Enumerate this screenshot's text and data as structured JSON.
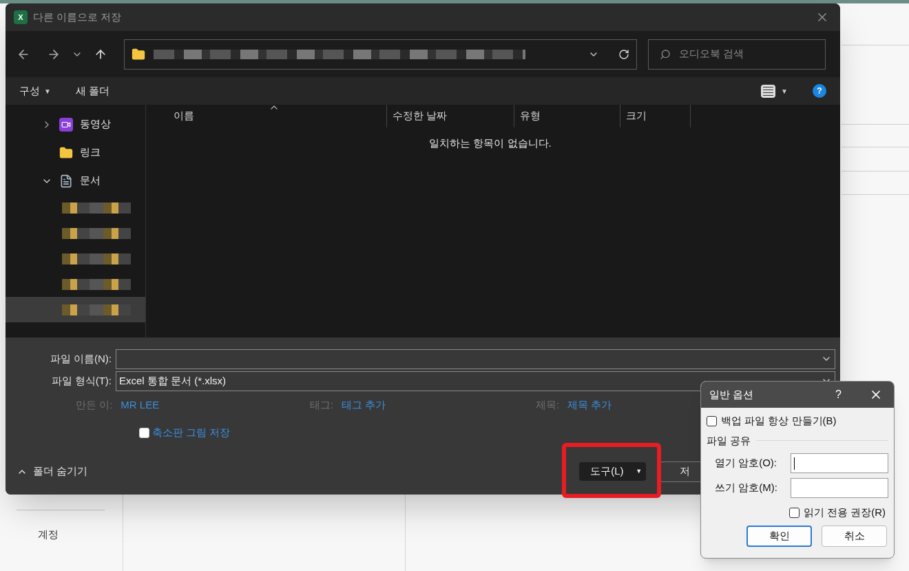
{
  "background": {
    "account": "계정"
  },
  "window": {
    "title": "다른 이름으로 저장"
  },
  "search": {
    "placeholder": "오디오북 검색"
  },
  "app_icon": "X",
  "toolbar": {
    "organize": "구성",
    "organize_caret": "▼",
    "new_folder": "새 폴더",
    "view_caret": "▼",
    "help": "?"
  },
  "sidebar": {
    "items": [
      {
        "label": "동영상",
        "kind": "videos",
        "expandable": true,
        "expanded": false
      },
      {
        "label": "링크",
        "kind": "folder",
        "expandable": false
      },
      {
        "label": "문서",
        "kind": "documents",
        "expandable": true,
        "expanded": true
      }
    ],
    "hidden_items": [
      {
        "selected": false
      },
      {
        "selected": false
      },
      {
        "selected": false
      },
      {
        "selected": false
      },
      {
        "selected": true
      }
    ]
  },
  "table": {
    "columns": [
      {
        "label": "이름",
        "sorted": true
      },
      {
        "label": "수정한 날짜",
        "sorted": false
      },
      {
        "label": "유형",
        "sorted": false
      },
      {
        "label": "크기",
        "sorted": false
      }
    ],
    "empty_message": "일치하는 항목이 없습니다."
  },
  "form": {
    "file_name": {
      "label": "파일 이름(N):"
    },
    "file_type": {
      "label": "파일 형식(T):",
      "value": "Excel 통합 문서 (*.xlsx)"
    },
    "meta": [
      {
        "label": "만든 이:",
        "value": "MR LEE"
      },
      {
        "label": "태그:",
        "value": "태그 추가"
      },
      {
        "label": "제목:",
        "value": "제목 추가"
      }
    ],
    "thumbnail": {
      "label": "축소판 그림 저장",
      "checked": false
    }
  },
  "footer": {
    "hide_folders": "폴더 숨기기",
    "tools": "도구(L)",
    "tools_caret": "▼",
    "save": "저"
  },
  "options_dialog": {
    "title": "일반 옵션",
    "help": "?",
    "backup": {
      "label": "백업 파일 항상 만들기(B)",
      "checked": false
    },
    "section": "파일 공유",
    "open_password": {
      "label": "열기 암호(O):"
    },
    "write_password": {
      "label": "쓰기 암호(M):"
    },
    "read_only": {
      "label": "읽기 전용 권장(R)",
      "checked": false
    },
    "ok": "확인",
    "cancel": "취소"
  }
}
